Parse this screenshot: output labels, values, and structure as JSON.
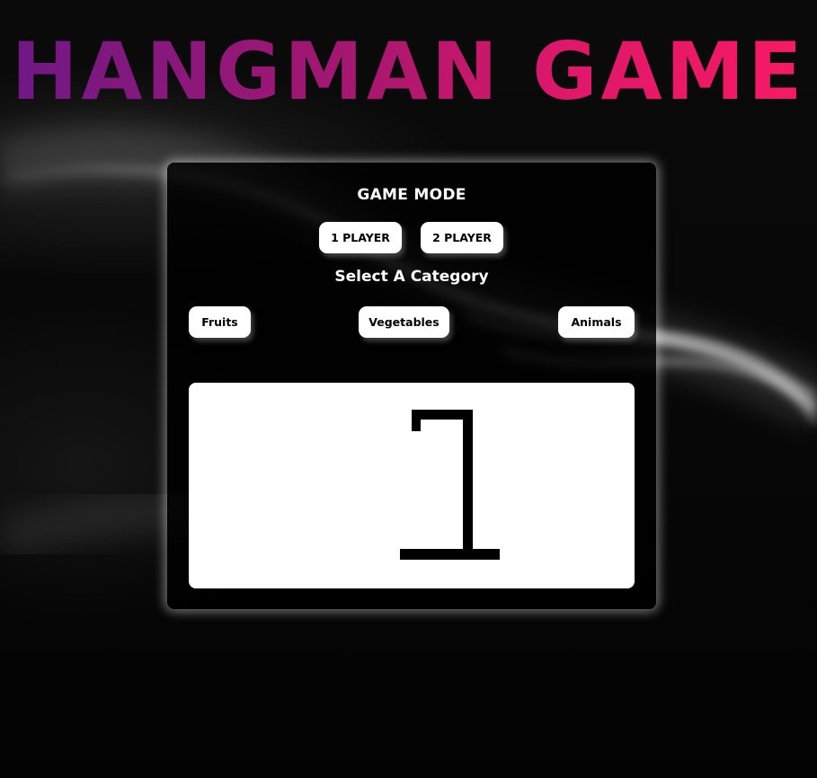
{
  "title": "HANGMAN GAME",
  "game_mode": {
    "heading": "GAME MODE",
    "one_player_label": "1 PLAYER",
    "two_player_label": "2 PLAYER"
  },
  "category": {
    "heading": "Select A Category",
    "options": [
      "Fruits",
      "Vegetables",
      "Animals"
    ]
  },
  "gallows": {
    "icon": "gallows-icon",
    "stage": "gallows-frame"
  },
  "colors": {
    "title_gradient_start": "#6e1886",
    "title_gradient_end": "#f71a62",
    "panel_background": "#000000",
    "button_background": "#ffffff",
    "board_background": "#ffffff"
  }
}
